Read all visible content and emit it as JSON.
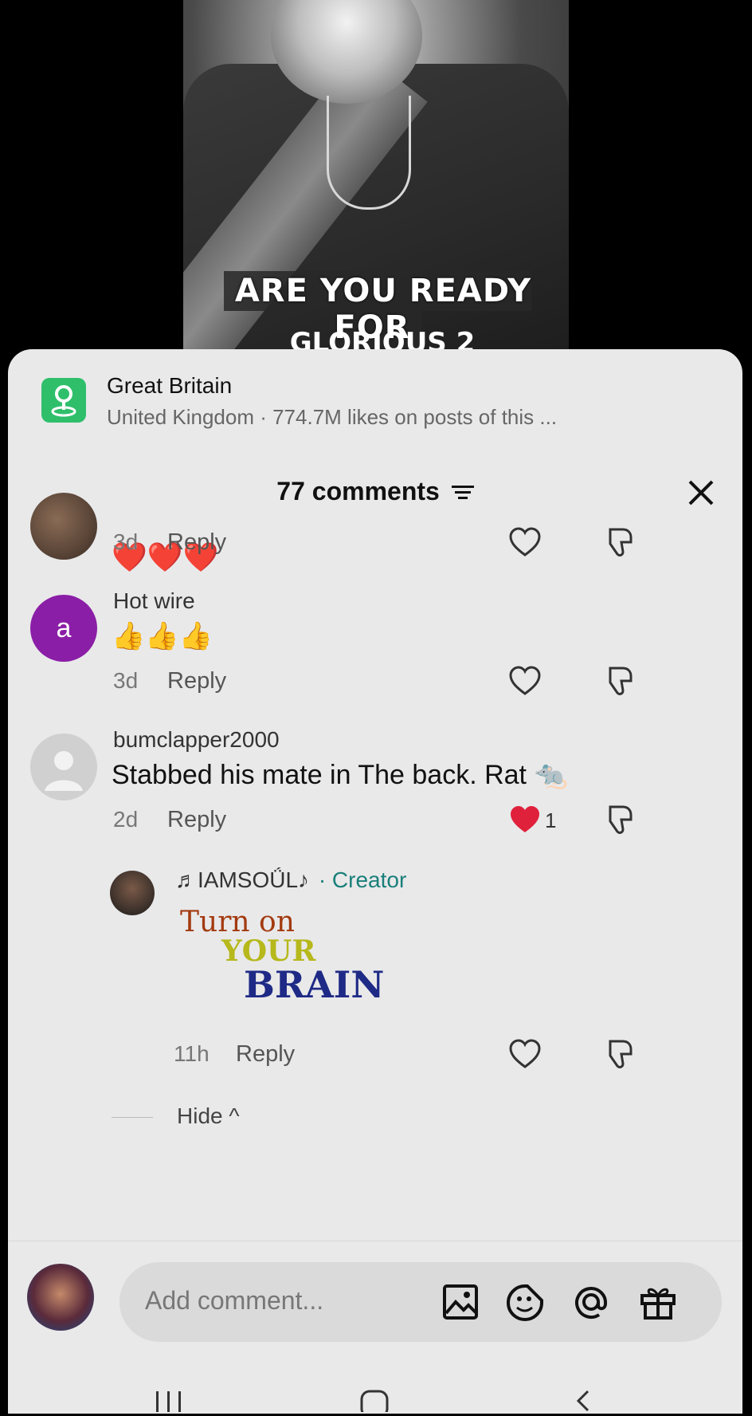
{
  "video": {
    "caption_line1": "ARE YOU READY FOR",
    "caption_line2": "GLORIOUS 2"
  },
  "location": {
    "title": "Great Britain",
    "subtitle": "United Kingdom · 774.7M likes on posts of this ..."
  },
  "comments_header": {
    "count_label": "77 comments"
  },
  "comments": [
    {
      "name": "",
      "text": "❤️❤️❤️",
      "age": "3d",
      "reply_label": "Reply",
      "likes": ""
    },
    {
      "name": "Hot wire",
      "avatar_letter": "a",
      "text": "👍👍👍",
      "age": "3d",
      "reply_label": "Reply",
      "likes": ""
    },
    {
      "name": "bumclapper2000",
      "text": "Stabbed his mate in The back. Rat 🐀",
      "age": "2d",
      "reply_label": "Reply",
      "likes": "1"
    }
  ],
  "creator_reply": {
    "name": "♬IAMSOǗL♪",
    "tag": "· Creator",
    "sticker_line1": "Turn on",
    "sticker_line2": "YOUR",
    "sticker_line3": "BRAIN",
    "age": "11h",
    "reply_label": "Reply"
  },
  "hide_label": "Hide ^",
  "input": {
    "placeholder": "Add comment..."
  },
  "colors": {
    "accent_green": "#2fbf6b",
    "creator_teal": "#1a7f7a",
    "like_red": "#e0213b",
    "avatar_purple": "#8b1ea6"
  }
}
